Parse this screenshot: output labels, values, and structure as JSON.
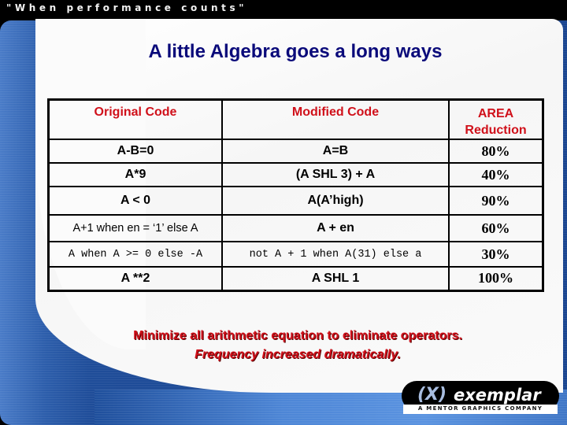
{
  "header": {
    "tagline": "\"When performance counts\""
  },
  "slide": {
    "title": "A little Algebra goes a long ways",
    "table": {
      "headers": [
        "Original Code",
        "Modified Code",
        "AREA Reduction"
      ],
      "header_color": "#d0101a",
      "rows": [
        {
          "original": "A-B=0",
          "modified": "A=B",
          "reduction": "80%"
        },
        {
          "original": "A*9",
          "modified": "(A SHL 3) + A",
          "reduction": "40%"
        },
        {
          "original": "A < 0",
          "modified": "A(A’high)",
          "reduction": "90%"
        },
        {
          "original": "A+1 when en = ‘1’ else A",
          "modified": "A + en",
          "reduction": "60%"
        },
        {
          "original": "A when A >= 0 else -A",
          "modified": "not A + 1 when A(31) else a",
          "reduction": "30%"
        },
        {
          "original": "A **2",
          "modified": "A SHL 1",
          "reduction": "100%"
        }
      ]
    },
    "notes": {
      "line1": "Minimize all arithmetic equation to eliminate operators.",
      "line2": "Frequency increased dramatically.",
      "color": "#d0101a"
    }
  },
  "logo": {
    "mark": "(X)",
    "name": "exemplar",
    "subtitle": "A MENTOR GRAPHICS COMPANY"
  },
  "colors": {
    "title": "#0a0a7a",
    "accent_blue": "#1f4d99"
  }
}
